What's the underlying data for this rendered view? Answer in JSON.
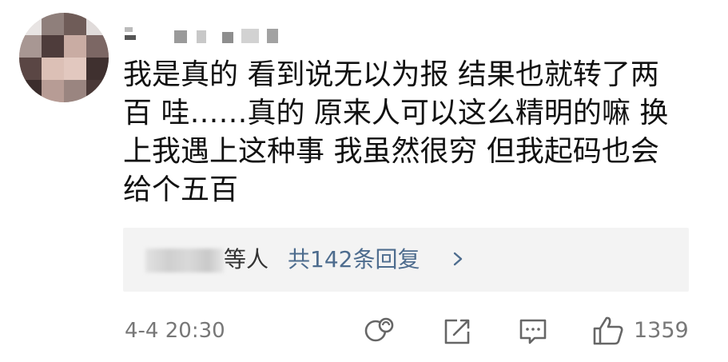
{
  "comment": {
    "author_name": "",
    "text": "我是真的 看到说无以为报 结果也就转了两百 哇……真的 原来人可以这么精明的嘛 换上我遇上这种事 我虽然很穷 但我起码也会给个五百",
    "time": "4-4 20:30",
    "like_count": "1359"
  },
  "replies": {
    "who_suffix": "等人",
    "count_label": "共142条回复"
  },
  "icons": {
    "avatar": "avatar-pixelated",
    "repost": "repost-icon",
    "share": "share-icon",
    "reply": "reply-icon",
    "like": "thumbs-up-icon",
    "chevron": "chevron-right-icon"
  },
  "colors": {
    "text": "#111111",
    "link": "#4d6c8e",
    "meta": "#777777",
    "reply_bg": "#f3f3f3"
  }
}
